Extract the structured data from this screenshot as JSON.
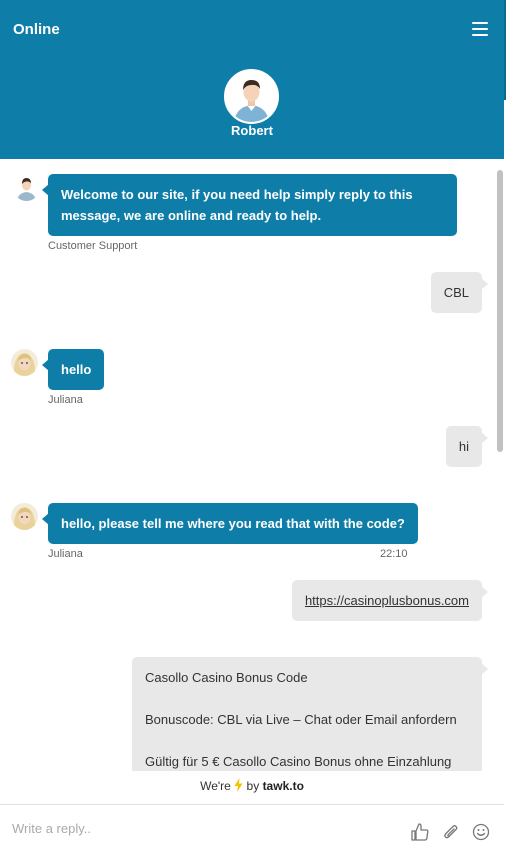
{
  "header": {
    "status": "Online",
    "agent_name": "Robert",
    "menu_icon": "hamburger-menu-icon"
  },
  "colors": {
    "brand": "#0e7ea8",
    "visitor_bubble": "#e8e8e8"
  },
  "messages": [
    {
      "from": "agent",
      "text": "Welcome to our site, if you need help simply reply to this message, we are online and ready to help.",
      "sender": "Customer Support"
    },
    {
      "from": "visitor",
      "text": "CBL"
    },
    {
      "from": "agent",
      "text": "hello",
      "sender": "Juliana"
    },
    {
      "from": "visitor",
      "text": "hi"
    },
    {
      "from": "agent",
      "text": "hello, please tell me where you read that with the code?",
      "sender": "Juliana",
      "time": "22:10"
    },
    {
      "from": "visitor",
      "text": "https://casinoplusbonus.com"
    },
    {
      "from": "visitor",
      "lines": [
        "Casollo Casino Bonus Code",
        "Bonuscode: CBL via Live – Chat oder Email anfordern",
        "Gültig für 5 € Casollo Casino Bonus ohne Einzahlung"
      ]
    }
  ],
  "branding": {
    "prefix": "We're",
    "by": "by",
    "brand": "tawk.to"
  },
  "composer": {
    "placeholder": "Write a reply..",
    "icons": [
      "thumbs-up-icon",
      "paperclip-icon",
      "emoji-icon"
    ]
  }
}
